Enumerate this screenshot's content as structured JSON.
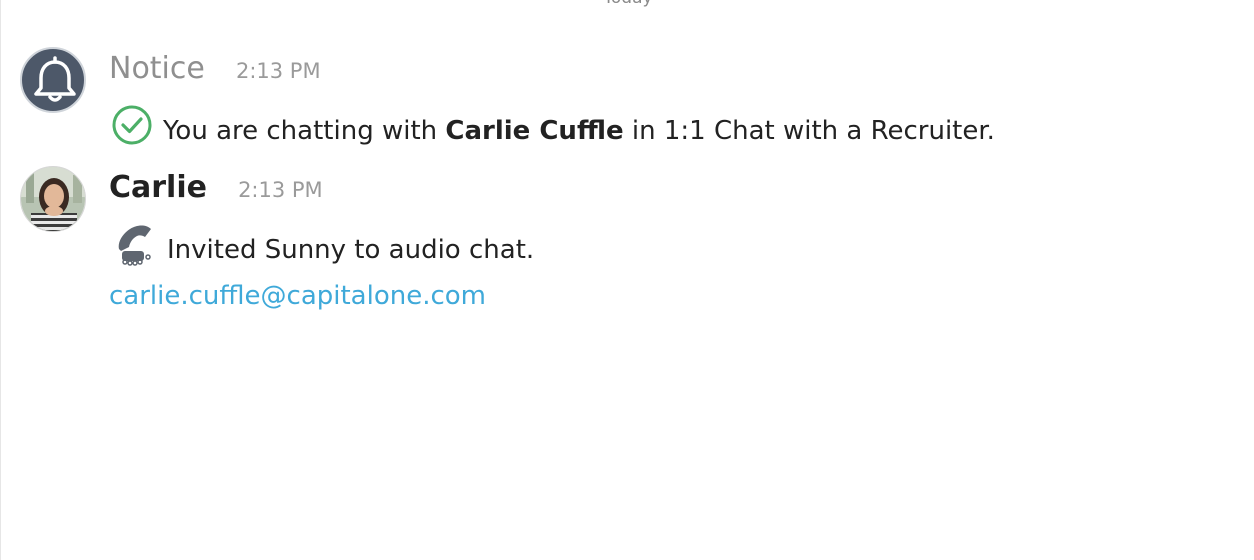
{
  "date_divider": "Today",
  "messages": [
    {
      "sender": "Notice",
      "time": "2:13 PM",
      "avatar_icon": "bell-icon",
      "status_icon": "check-circle-icon",
      "text_before": "You are chatting with",
      "bold_name": "Carlie Cuffle",
      "text_after": "in 1:1 Chat with a Recruiter."
    },
    {
      "sender": "Carlie",
      "time": "2:13 PM",
      "avatar_icon": "user-photo",
      "call_icon": "telephone-icon",
      "text": "Invited Sunny to audio chat.",
      "email": "carlie.cuffle@capitalone.com"
    }
  ],
  "colors": {
    "notice_avatar_bg": "#4d5869",
    "check_green": "#4caf67",
    "link_blue": "#3fa9d9",
    "muted_gray": "#9a9a9a"
  }
}
